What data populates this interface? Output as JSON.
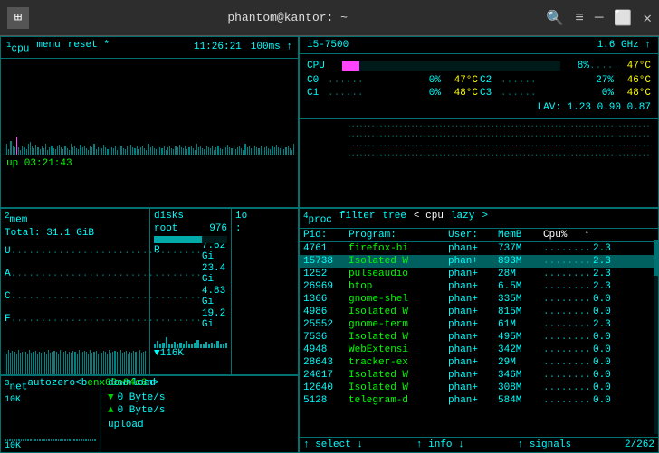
{
  "titlebar": {
    "icon": "👤",
    "title": "phantom@kantor: ~",
    "search_icon": "🔍",
    "menu_icon": "≡",
    "minimize_icon": "─",
    "maximize_icon": "⬜",
    "close_icon": "✕"
  },
  "cpu_panel": {
    "label": "¹cpu",
    "menu": "menu",
    "reset": "reset *",
    "time": "11:26:21",
    "interval": "100ms ↑",
    "model": "i5-7500",
    "freq": "1.6 GHz ↑",
    "cpu_pct": "8%",
    "cpu_temp": "47°C",
    "uptime": "up 03:21:43",
    "cores": [
      {
        "name": "C0",
        "pct": "0%",
        "temp": "47°C"
      },
      {
        "name": "C2",
        "pct": "27%",
        "temp": "46°C"
      },
      {
        "name": "C1",
        "pct": "0%",
        "temp": "48°C"
      },
      {
        "name": "C3",
        "pct": "0%",
        "temp": "48°C"
      }
    ],
    "lav": "LAV: 1.23 0.90 0.87"
  },
  "mem_panel": {
    "label": "²mem",
    "total": "Total: 31.1 GiB",
    "rows": [
      {
        "key": "U",
        "val": "7.62 Gi"
      },
      {
        "key": "A",
        "val": "23.4 Gi"
      },
      {
        "key": "C",
        "val": "4.83 Gi"
      },
      {
        "key": "F",
        "val": "19.2 Gi"
      }
    ],
    "disks_label": "disks",
    "disk_root": "root",
    "disk_root_val": "976",
    "disk_root_pct": 65,
    "disk_r": "R",
    "io_label": "io",
    "io_val": ":",
    "disk_bottom": "▼116K"
  },
  "net_panel": {
    "label": "³net",
    "auto": "auto",
    "zero": "zero",
    "b_label": "<b",
    "interface": "enx00e04c6",
    "n_label": "n>",
    "top_val": "10K",
    "bottom_val": "10K",
    "download_label": "download",
    "down_arrow": "▼",
    "down_speed": "0 Byte/s",
    "up_arrow": "▲",
    "up_speed": "0 Byte/s",
    "upload_label": "upload"
  },
  "proc_panel": {
    "label": "⁴proc",
    "filter": "filter",
    "tree": "tree",
    "cpu_sort": "< cpu",
    "lazy": "lazy",
    "expand": ">",
    "columns": [
      "Pid:",
      "Program:",
      "User:",
      "MemB",
      "Cpu%",
      "↑"
    ],
    "rows": [
      {
        "pid": "4761",
        "prog": "firefox-bi",
        "user": "phan+",
        "mem": "737M",
        "cpu": "2.3",
        "bar": "▊▊▊▊▊▊",
        "selected": false
      },
      {
        "pid": "15738",
        "prog": "Isolated W",
        "user": "phan+",
        "mem": "893M",
        "cpu": "2.3",
        "bar": "▊▊▊▊▊▊",
        "selected": true
      },
      {
        "pid": "1252",
        "prog": "pulseaudio",
        "user": "phan+",
        "mem": "28M",
        "cpu": "2.3",
        "bar": "........",
        "selected": false
      },
      {
        "pid": "26969",
        "prog": "btop",
        "user": "phan+",
        "mem": "6.5M",
        "cpu": "2.3",
        "bar": "........",
        "selected": false
      },
      {
        "pid": "1366",
        "prog": "gnome-shel",
        "user": "phan+",
        "mem": "335M",
        "cpu": "0.0",
        "bar": "........",
        "selected": false
      },
      {
        "pid": "4986",
        "prog": "Isolated W",
        "user": "phan+",
        "mem": "815M",
        "cpu": "0.0",
        "bar": "........",
        "selected": false
      },
      {
        "pid": "25552",
        "prog": "gnome-term",
        "user": "phan+",
        "mem": "61M",
        "cpu": "2.3",
        "bar": "........",
        "selected": false
      },
      {
        "pid": "7536",
        "prog": "Isolated W",
        "user": "phan+",
        "mem": "495M",
        "cpu": "0.0",
        "bar": "........",
        "selected": false
      },
      {
        "pid": "4948",
        "prog": "WebExtensi",
        "user": "phan+",
        "mem": "342M",
        "cpu": "0.0",
        "bar": "........",
        "selected": false
      },
      {
        "pid": "28643",
        "prog": "tracker-ex",
        "user": "phan+",
        "mem": "29M",
        "cpu": "0.0",
        "bar": "........",
        "selected": false
      },
      {
        "pid": "24017",
        "prog": "Isolated W",
        "user": "phan+",
        "mem": "346M",
        "cpu": "0.0",
        "bar": "........",
        "selected": false
      },
      {
        "pid": "12640",
        "prog": "Isolated W",
        "user": "phan+",
        "mem": "308M",
        "cpu": "0.0",
        "bar": "........",
        "selected": false
      },
      {
        "pid": "5128",
        "prog": "telegram-d",
        "user": "phan+",
        "mem": "584M",
        "cpu": "0.0",
        "bar": "........",
        "selected": false
      }
    ],
    "footer": {
      "select": "↑ select ↓",
      "info": "↑ info ↓",
      "signals": "↑ signals",
      "page": "2/262"
    }
  }
}
